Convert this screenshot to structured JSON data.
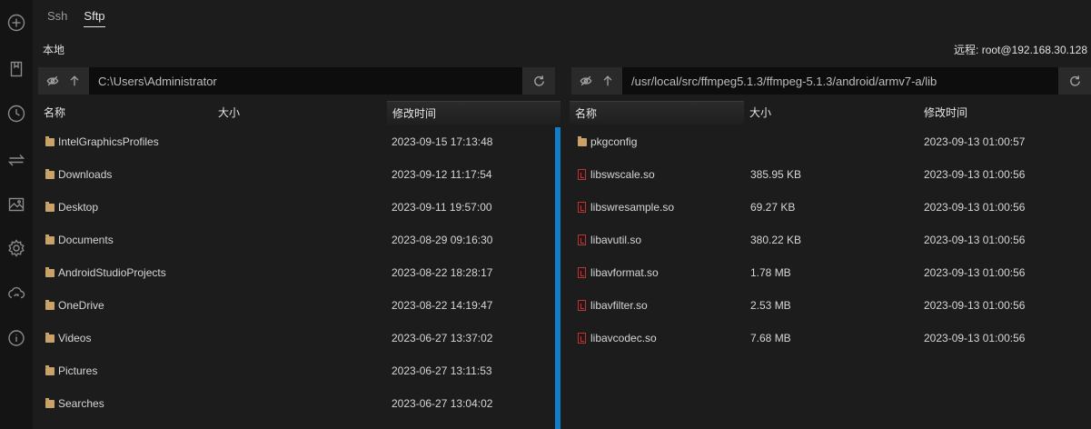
{
  "tabs": [
    {
      "label": "Ssh",
      "active": false
    },
    {
      "label": "Sftp",
      "active": true
    }
  ],
  "rail_icons": [
    "add-circle-icon",
    "bookmark-icon",
    "clock-icon",
    "transfer-icon",
    "image-icon",
    "gear-icon",
    "cloud-sync-icon",
    "info-icon"
  ],
  "local": {
    "label": "本地",
    "path": "C:\\Users\\Administrator",
    "columns": {
      "name": "名称",
      "size": "大小",
      "modified": "修改时间"
    },
    "sorted_column": "modified",
    "rows": [
      {
        "name": "IntelGraphicsProfiles",
        "size": "",
        "modified": "2023-09-15 17:13:48",
        "type": "folder"
      },
      {
        "name": "Downloads",
        "size": "",
        "modified": "2023-09-12 11:17:54",
        "type": "folder"
      },
      {
        "name": "Desktop",
        "size": "",
        "modified": "2023-09-11 19:57:00",
        "type": "folder"
      },
      {
        "name": "Documents",
        "size": "",
        "modified": "2023-08-29 09:16:30",
        "type": "folder"
      },
      {
        "name": "AndroidStudioProjects",
        "size": "",
        "modified": "2023-08-22 18:28:17",
        "type": "folder"
      },
      {
        "name": "OneDrive",
        "size": "",
        "modified": "2023-08-22 14:19:47",
        "type": "folder"
      },
      {
        "name": "Videos",
        "size": "",
        "modified": "2023-06-27 13:37:02",
        "type": "folder"
      },
      {
        "name": "Pictures",
        "size": "",
        "modified": "2023-06-27 13:11:53",
        "type": "folder"
      },
      {
        "name": "Searches",
        "size": "",
        "modified": "2023-06-27 13:04:02",
        "type": "folder"
      }
    ]
  },
  "remote": {
    "label": "远程: root@192.168.30.128",
    "path": "/usr/local/src/ffmpeg5.1.3/ffmpeg-5.1.3/android/armv7-a/lib",
    "columns": {
      "name": "名称",
      "size": "大小",
      "modified": "修改时间"
    },
    "sorted_column": "name",
    "rows": [
      {
        "name": "pkgconfig",
        "size": "",
        "modified": "2023-09-13 01:00:57",
        "type": "folder"
      },
      {
        "name": "libswscale.so",
        "size": "385.95 KB",
        "modified": "2023-09-13 01:00:56",
        "type": "file"
      },
      {
        "name": "libswresample.so",
        "size": "69.27 KB",
        "modified": "2023-09-13 01:00:56",
        "type": "file"
      },
      {
        "name": "libavutil.so",
        "size": "380.22 KB",
        "modified": "2023-09-13 01:00:56",
        "type": "file"
      },
      {
        "name": "libavformat.so",
        "size": "1.78 MB",
        "modified": "2023-09-13 01:00:56",
        "type": "file"
      },
      {
        "name": "libavfilter.so",
        "size": "2.53 MB",
        "modified": "2023-09-13 01:00:56",
        "type": "file"
      },
      {
        "name": "libavcodec.so",
        "size": "7.68 MB",
        "modified": "2023-09-13 01:00:56",
        "type": "file"
      }
    ]
  },
  "colors": {
    "accent_divider": "#0f7ec8",
    "folder_icon": "#c9a26a",
    "file_icon": "#b03a3a"
  }
}
